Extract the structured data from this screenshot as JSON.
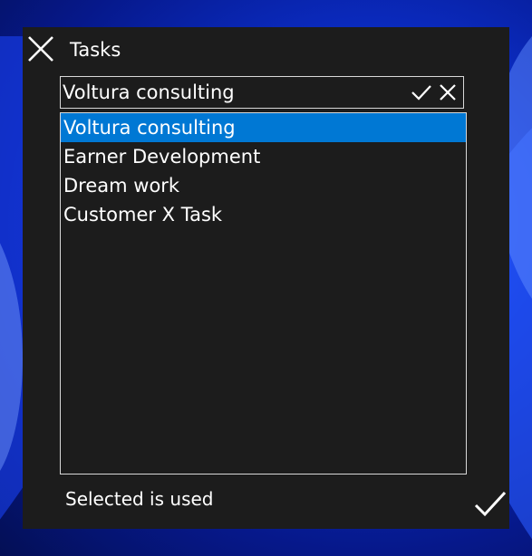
{
  "dialog": {
    "title": "Tasks",
    "close_icon": "close-icon",
    "confirm_icon": "checkmark-icon"
  },
  "combo": {
    "value": "Voltura consulting",
    "confirm_icon": "checkmark-icon",
    "clear_icon": "close-icon"
  },
  "list": {
    "items": [
      {
        "label": "Voltura consulting",
        "selected": true
      },
      {
        "label": "Earner Development",
        "selected": false
      },
      {
        "label": "Dream work",
        "selected": false
      },
      {
        "label": "Customer X Task",
        "selected": false
      }
    ]
  },
  "status": {
    "text": "Selected is used"
  },
  "colors": {
    "dialog_bg": "#1c1c1c",
    "selection": "#0078d4",
    "border": "#d8d8d8",
    "wallpaper": "#0a2fd6"
  }
}
